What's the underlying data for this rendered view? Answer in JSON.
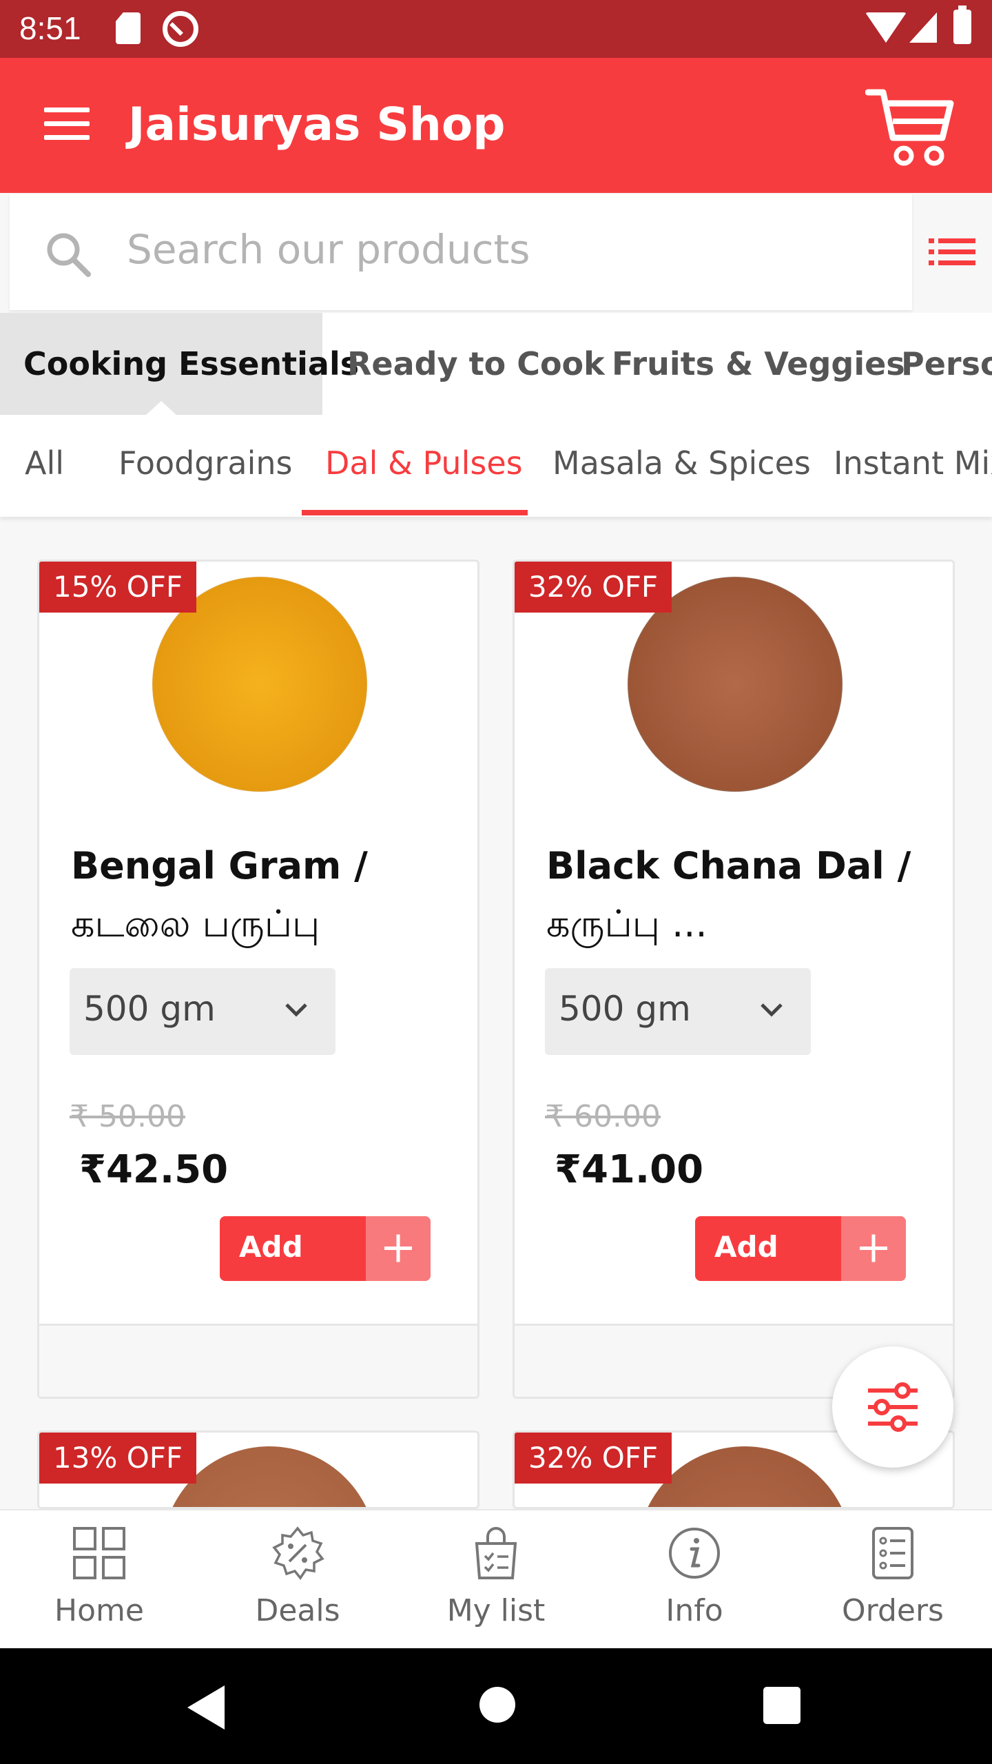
{
  "status": {
    "time": "8:51"
  },
  "appbar": {
    "title": "Jaisuryas Shop"
  },
  "search": {
    "placeholder": "Search our products"
  },
  "categories": [
    {
      "label": "Cooking Essentials",
      "active": true
    },
    {
      "label": "Ready to Cook",
      "active": false
    },
    {
      "label": "Fruits & Veggies",
      "active": false
    },
    {
      "label": "Personal Care",
      "active": false
    }
  ],
  "subcategories": [
    {
      "label": "All",
      "active": false
    },
    {
      "label": "Foodgrains",
      "active": false
    },
    {
      "label": "Dal & Pulses",
      "active": true
    },
    {
      "label": "Masala & Spices",
      "active": false
    },
    {
      "label": "Instant Mixes",
      "active": false
    }
  ],
  "products": [
    {
      "discount": "15% OFF",
      "name": "Bengal Gram /",
      "name_tamil": "கடலை பருப்பு",
      "quantity": "500 gm",
      "mrp": "₹ 50.00",
      "price": "₹42.50",
      "add_label": "Add",
      "image_color": "#f0a818"
    },
    {
      "discount": "32% OFF",
      "name": "Black Chana Dal /",
      "name_tamil": "கருப்பு ...",
      "quantity": "500 gm",
      "mrp": "₹ 60.00",
      "price": "₹41.00",
      "add_label": "Add",
      "image_color": "#a8603f"
    },
    {
      "discount": "13% OFF",
      "image_color": "#b06a48"
    },
    {
      "discount": "32% OFF",
      "image_color": "#a8603f"
    }
  ],
  "bottom_nav": [
    {
      "label": "Home",
      "icon": "home-grid-icon"
    },
    {
      "label": "Deals",
      "icon": "deals-badge-icon"
    },
    {
      "label": "My list",
      "icon": "shopping-bag-icon"
    },
    {
      "label": "Info",
      "icon": "info-icon"
    },
    {
      "label": "Orders",
      "icon": "orders-list-icon"
    }
  ],
  "colors": {
    "brand_red": "#f73c3f",
    "status_bar": "#b0272c",
    "badge_red": "#cf2628"
  }
}
